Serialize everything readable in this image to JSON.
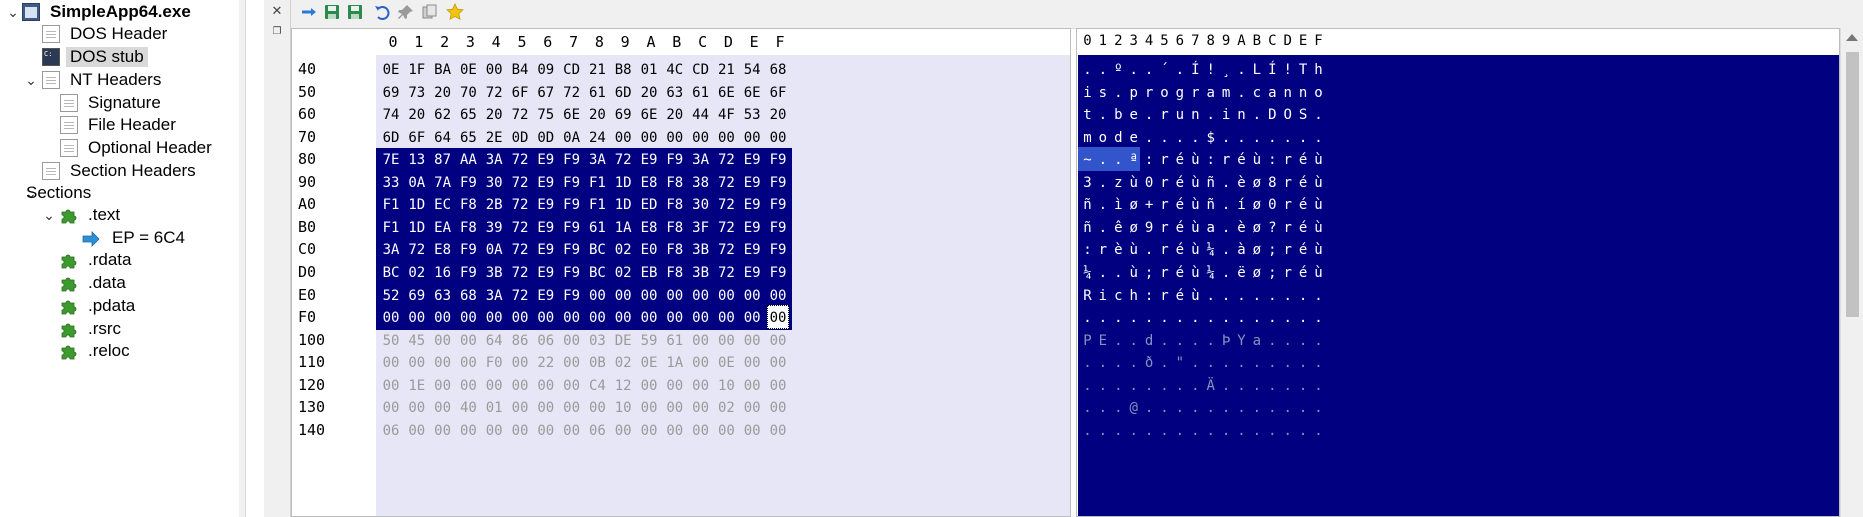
{
  "app": {
    "file_name": "SimpleApp64.exe"
  },
  "tree": [
    {
      "label": "SimpleApp64.exe",
      "icon": "exe-icon",
      "expanded": true
    },
    {
      "label": "DOS Header",
      "icon": "document-icon"
    },
    {
      "label": "DOS stub",
      "icon": "dos-console-icon",
      "selected": true
    },
    {
      "label": "NT Headers",
      "icon": "document-icon",
      "expanded": true
    },
    {
      "label": "Signature",
      "icon": "document-icon"
    },
    {
      "label": "File Header",
      "icon": "document-icon"
    },
    {
      "label": "Optional Header",
      "icon": "document-icon"
    },
    {
      "label": "Section Headers",
      "icon": "document-icon"
    },
    {
      "label": "Sections",
      "icon": "none",
      "expanded": true
    },
    {
      "label": ".text",
      "icon": "puzzle-icon",
      "expanded": true
    },
    {
      "label": "EP = 6C4",
      "icon": "arrow-right-icon"
    },
    {
      "label": ".rdata",
      "icon": "puzzle-icon"
    },
    {
      "label": ".data",
      "icon": "puzzle-icon"
    },
    {
      "label": ".pdata",
      "icon": "puzzle-icon"
    },
    {
      "label": ".rsrc",
      "icon": "puzzle-icon"
    },
    {
      "label": ".reloc",
      "icon": "puzzle-icon"
    }
  ],
  "toolbar": {
    "buttons": [
      "go-to-offset-icon",
      "save-icon",
      "save-as-icon",
      "undo-icon",
      "pin-icon",
      "copy-icon",
      "bookmark-star-icon"
    ]
  },
  "minibar": {
    "buttons": [
      "close-icon",
      "restore-icon"
    ]
  },
  "hex": {
    "column_headers": [
      "0",
      "1",
      "2",
      "3",
      "4",
      "5",
      "6",
      "7",
      "8",
      "9",
      "A",
      "B",
      "C",
      "D",
      "E",
      "F"
    ],
    "rows": [
      {
        "addr": "40",
        "bytes": [
          "0E",
          "1F",
          "BA",
          "0E",
          "00",
          "B4",
          "09",
          "CD",
          "21",
          "B8",
          "01",
          "4C",
          "CD",
          "21",
          "54",
          "68"
        ],
        "style": "n"
      },
      {
        "addr": "50",
        "bytes": [
          "69",
          "73",
          "20",
          "70",
          "72",
          "6F",
          "67",
          "72",
          "61",
          "6D",
          "20",
          "63",
          "61",
          "6E",
          "6E",
          "6F"
        ],
        "style": "n"
      },
      {
        "addr": "60",
        "bytes": [
          "74",
          "20",
          "62",
          "65",
          "20",
          "72",
          "75",
          "6E",
          "20",
          "69",
          "6E",
          "20",
          "44",
          "4F",
          "53",
          "20"
        ],
        "style": "n"
      },
      {
        "addr": "70",
        "bytes": [
          "6D",
          "6F",
          "64",
          "65",
          "2E",
          "0D",
          "0D",
          "0A",
          "24",
          "00",
          "00",
          "00",
          "00",
          "00",
          "00",
          "00"
        ],
        "style": "n"
      },
      {
        "addr": "80",
        "bytes": [
          "7E",
          "13",
          "87",
          "AA",
          "3A",
          "72",
          "E9",
          "F9",
          "3A",
          "72",
          "E9",
          "F9",
          "3A",
          "72",
          "E9",
          "F9"
        ],
        "style": "s"
      },
      {
        "addr": "90",
        "bytes": [
          "33",
          "0A",
          "7A",
          "F9",
          "30",
          "72",
          "E9",
          "F9",
          "F1",
          "1D",
          "E8",
          "F8",
          "38",
          "72",
          "E9",
          "F9"
        ],
        "style": "s"
      },
      {
        "addr": "A0",
        "bytes": [
          "F1",
          "1D",
          "EC",
          "F8",
          "2B",
          "72",
          "E9",
          "F9",
          "F1",
          "1D",
          "ED",
          "F8",
          "30",
          "72",
          "E9",
          "F9"
        ],
        "style": "s"
      },
      {
        "addr": "B0",
        "bytes": [
          "F1",
          "1D",
          "EA",
          "F8",
          "39",
          "72",
          "E9",
          "F9",
          "61",
          "1A",
          "E8",
          "F8",
          "3F",
          "72",
          "E9",
          "F9"
        ],
        "style": "s"
      },
      {
        "addr": "C0",
        "bytes": [
          "3A",
          "72",
          "E8",
          "F9",
          "0A",
          "72",
          "E9",
          "F9",
          "BC",
          "02",
          "E0",
          "F8",
          "3B",
          "72",
          "E9",
          "F9"
        ],
        "style": "s"
      },
      {
        "addr": "D0",
        "bytes": [
          "BC",
          "02",
          "16",
          "F9",
          "3B",
          "72",
          "E9",
          "F9",
          "BC",
          "02",
          "EB",
          "F8",
          "3B",
          "72",
          "E9",
          "F9"
        ],
        "style": "s"
      },
      {
        "addr": "E0",
        "bytes": [
          "52",
          "69",
          "63",
          "68",
          "3A",
          "72",
          "E9",
          "F9",
          "00",
          "00",
          "00",
          "00",
          "00",
          "00",
          "00",
          "00"
        ],
        "style": "s"
      },
      {
        "addr": "F0",
        "bytes": [
          "00",
          "00",
          "00",
          "00",
          "00",
          "00",
          "00",
          "00",
          "00",
          "00",
          "00",
          "00",
          "00",
          "00",
          "00",
          "00"
        ],
        "style": "s"
      },
      {
        "addr": "100",
        "bytes": [
          "50",
          "45",
          "00",
          "00",
          "64",
          "86",
          "06",
          "00",
          "03",
          "DE",
          "59",
          "61",
          "00",
          "00",
          "00",
          "00"
        ],
        "style": "g"
      },
      {
        "addr": "110",
        "bytes": [
          "00",
          "00",
          "00",
          "00",
          "F0",
          "00",
          "22",
          "00",
          "0B",
          "02",
          "0E",
          "1A",
          "00",
          "0E",
          "00",
          "00"
        ],
        "style": "g"
      },
      {
        "addr": "120",
        "bytes": [
          "00",
          "1E",
          "00",
          "00",
          "00",
          "00",
          "00",
          "00",
          "C4",
          "12",
          "00",
          "00",
          "00",
          "10",
          "00",
          "00"
        ],
        "style": "g"
      },
      {
        "addr": "130",
        "bytes": [
          "00",
          "00",
          "00",
          "40",
          "01",
          "00",
          "00",
          "00",
          "00",
          "10",
          "00",
          "00",
          "00",
          "02",
          "00",
          "00"
        ],
        "style": "g"
      },
      {
        "addr": "140",
        "bytes": [
          "06",
          "00",
          "00",
          "00",
          "00",
          "00",
          "00",
          "00",
          "06",
          "00",
          "00",
          "00",
          "00",
          "00",
          "00",
          "00"
        ],
        "style": "g"
      }
    ]
  },
  "ascii": {
    "column_headers": [
      "0",
      "1",
      "2",
      "3",
      "4",
      "5",
      "6",
      "7",
      "8",
      "9",
      "A",
      "B",
      "C",
      "D",
      "E",
      "F"
    ],
    "rows": [
      {
        "chars": [
          ".",
          ".",
          "º",
          ".",
          ".",
          "´",
          ".",
          "Í",
          "!",
          "¸",
          ".",
          "L",
          "Í",
          "!",
          "T",
          "h"
        ],
        "style": "n"
      },
      {
        "chars": [
          "i",
          "s",
          ".",
          "p",
          "r",
          "o",
          "g",
          "r",
          "a",
          "m",
          ".",
          "c",
          "a",
          "n",
          "n",
          "o"
        ],
        "style": "n"
      },
      {
        "chars": [
          "t",
          ".",
          "b",
          "e",
          ".",
          "r",
          "u",
          "n",
          ".",
          "i",
          "n",
          ".",
          "D",
          "O",
          "S",
          "."
        ],
        "style": "n"
      },
      {
        "chars": [
          "m",
          "o",
          "d",
          "e",
          ".",
          ".",
          ".",
          ".",
          "$",
          ".",
          ".",
          ".",
          ".",
          ".",
          ".",
          "."
        ],
        "style": "n"
      },
      {
        "chars": [
          "~",
          ".",
          ".",
          "ª",
          ":",
          "r",
          "é",
          "ù",
          ":",
          "r",
          "é",
          "ù",
          ":",
          "r",
          "é",
          "ù"
        ],
        "style": "n"
      },
      {
        "chars": [
          "3",
          ".",
          "z",
          "ù",
          "0",
          "r",
          "é",
          "ù",
          "ñ",
          ".",
          "è",
          "ø",
          "8",
          "r",
          "é",
          "ù"
        ],
        "style": "n"
      },
      {
        "chars": [
          "ñ",
          ".",
          "ì",
          "ø",
          "+",
          "r",
          "é",
          "ù",
          "ñ",
          ".",
          "í",
          "ø",
          "0",
          "r",
          "é",
          "ù"
        ],
        "style": "n"
      },
      {
        "chars": [
          "ñ",
          ".",
          "ê",
          "ø",
          "9",
          "r",
          "é",
          "ù",
          "a",
          ".",
          "è",
          "ø",
          "?",
          "r",
          "é",
          "ù"
        ],
        "style": "n"
      },
      {
        "chars": [
          ":",
          "r",
          "è",
          "ù",
          ".",
          "r",
          "é",
          "ù",
          "¼",
          ".",
          "à",
          "ø",
          ";",
          "r",
          "é",
          "ù"
        ],
        "style": "n"
      },
      {
        "chars": [
          "¼",
          ".",
          ".",
          "ù",
          ";",
          "r",
          "é",
          "ù",
          "¼",
          ".",
          "ë",
          "ø",
          ";",
          "r",
          "é",
          "ù"
        ],
        "style": "n"
      },
      {
        "chars": [
          "R",
          "i",
          "c",
          "h",
          ":",
          "r",
          "é",
          "ù",
          ".",
          ".",
          ".",
          ".",
          ".",
          ".",
          ".",
          "."
        ],
        "style": "n"
      },
      {
        "chars": [
          ".",
          ".",
          ".",
          ".",
          ".",
          ".",
          ".",
          ".",
          ".",
          ".",
          ".",
          ".",
          ".",
          ".",
          ".",
          "."
        ],
        "style": "n"
      },
      {
        "chars": [
          "P",
          "E",
          ".",
          ".",
          "d",
          ".",
          ".",
          ".",
          ".",
          "Þ",
          "Y",
          "a",
          ".",
          ".",
          ".",
          "."
        ],
        "style": "g"
      },
      {
        "chars": [
          ".",
          ".",
          ".",
          ".",
          "ð",
          ".",
          "\"",
          ".",
          ".",
          ".",
          ".",
          ".",
          ".",
          ".",
          ".",
          "."
        ],
        "style": "g"
      },
      {
        "chars": [
          ".",
          ".",
          ".",
          ".",
          ".",
          ".",
          ".",
          ".",
          "Ä",
          ".",
          ".",
          ".",
          ".",
          ".",
          ".",
          "."
        ],
        "style": "g"
      },
      {
        "chars": [
          ".",
          ".",
          ".",
          "@",
          ".",
          ".",
          ".",
          ".",
          ".",
          ".",
          ".",
          ".",
          ".",
          ".",
          ".",
          "."
        ],
        "style": "g"
      },
      {
        "chars": [
          ".",
          ".",
          ".",
          ".",
          ".",
          ".",
          ".",
          ".",
          ".",
          ".",
          ".",
          ".",
          ".",
          ".",
          ".",
          "."
        ],
        "style": "g"
      }
    ]
  },
  "colors": {
    "selection": "#000080",
    "unselected_bg": "#e6e6f7",
    "gray_text": "#9a9a9a"
  }
}
